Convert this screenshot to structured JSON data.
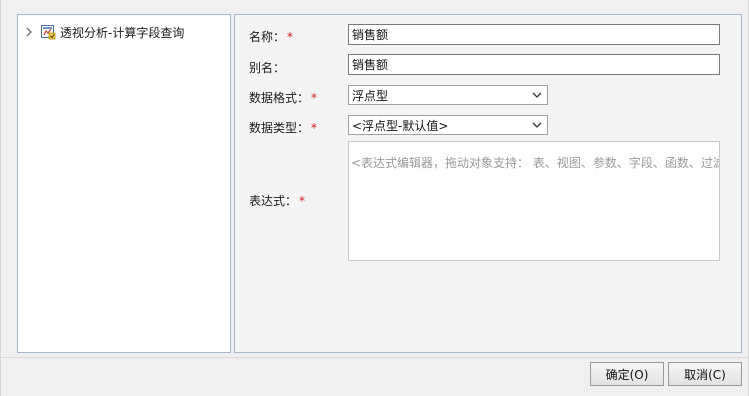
{
  "tree": {
    "node_label": "透视分析-计算字段查询",
    "chevron_icon": "chevron-right-icon",
    "node_icon": "query-report-icon"
  },
  "form": {
    "name_label": "名称：",
    "name_value": "销售额",
    "alias_label": "别名：",
    "alias_value": "销售额",
    "format_label": "数据格式：",
    "format_value": "浮点型",
    "type_label": "数据类型：",
    "type_value": "<浮点型-默认值>",
    "expression_label": "表达式：",
    "expression_placeholder": "<表达式编辑器，拖动对象支持： 表、视图、参数、字段、函数、过滤器、注",
    "required_mark": "*"
  },
  "buttons": {
    "ok_label": "确定(O)",
    "cancel_label": "取消(C)"
  },
  "colors": {
    "required": "#d02020",
    "panel_border": "#a8b8c8",
    "placeholder": "#9a9a9a"
  }
}
